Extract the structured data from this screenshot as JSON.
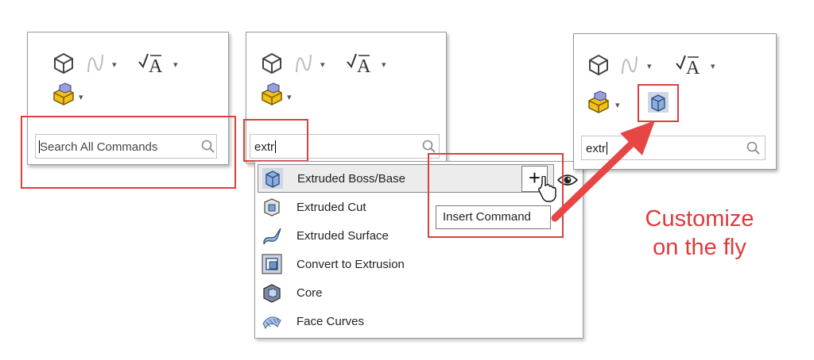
{
  "panel_initial": {
    "search_placeholder": "Search All Commands"
  },
  "panel_search": {
    "search_value": "extr"
  },
  "panel_result": {
    "search_value": "extr"
  },
  "results": [
    {
      "label": "Extruded Boss/Base",
      "icon": "extruded-boss-icon",
      "selected": true
    },
    {
      "label": "Extruded Cut",
      "icon": "extruded-cut-icon"
    },
    {
      "label": "Extruded Surface",
      "icon": "extruded-surface-icon"
    },
    {
      "label": "Convert to Extrusion",
      "icon": "convert-to-extrusion-icon"
    },
    {
      "label": "Core",
      "icon": "core-icon"
    },
    {
      "label": "Face Curves",
      "icon": "face-curves-icon"
    }
  ],
  "tooltip": "Insert Command",
  "insert_symbol": "+",
  "callout": {
    "line1": "Customize",
    "line2": "on the fly"
  },
  "colors": {
    "highlight": "#d94040",
    "callout_text": "#e0393d",
    "arrow": "#e84545"
  }
}
